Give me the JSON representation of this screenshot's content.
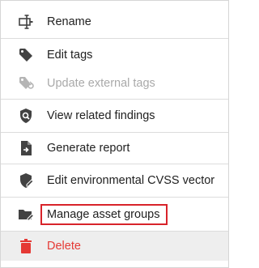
{
  "menu": {
    "items": [
      {
        "label": "Rename",
        "icon": "rename-icon",
        "enabled": true
      },
      {
        "label": "Edit tags",
        "icon": "tag-icon",
        "enabled": true
      },
      {
        "label": "Update external tags",
        "icon": "tag-sync-icon",
        "enabled": false
      },
      {
        "label": "View related findings",
        "icon": "shield-search-icon",
        "enabled": true
      },
      {
        "label": "Generate report",
        "icon": "report-icon",
        "enabled": true
      },
      {
        "label": "Edit environmental CVSS vector",
        "icon": "shield-edit-icon",
        "enabled": true
      },
      {
        "label": "Manage asset groups",
        "icon": "folder-edit-icon",
        "enabled": true,
        "highlighted": true
      },
      {
        "label": "Delete",
        "icon": "trash-icon",
        "enabled": true,
        "destructive": true
      }
    ]
  },
  "colors": {
    "icon": "#424242",
    "disabled": "#a9a9a9",
    "delete": "#e53935",
    "highlight_border": "#d8232a",
    "accent": "#7b57a8"
  }
}
